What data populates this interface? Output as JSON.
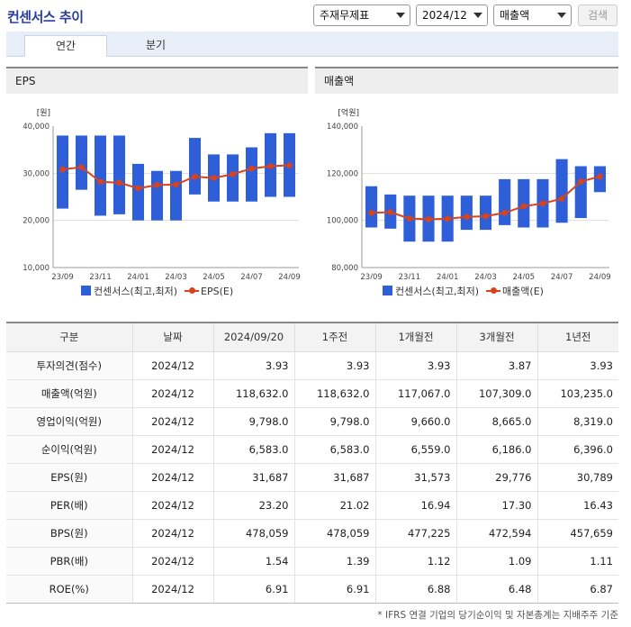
{
  "header": {
    "title": "컨센서스 추이",
    "select_report": "주재무제표",
    "select_period": "2024/12",
    "select_metric": "매출액",
    "search_label": "검색"
  },
  "tabs": [
    {
      "label": "연간",
      "active": true
    },
    {
      "label": "분기",
      "active": false
    }
  ],
  "colors": {
    "bar": "#2f5fd8",
    "line": "#d8431b",
    "title": "#2a3f9b"
  },
  "chart_data": [
    {
      "type": "bar",
      "panel_title": "EPS",
      "unit_label": "[원]",
      "x": [
        "23/09",
        "23/10",
        "23/11",
        "23/12",
        "24/01",
        "24/02",
        "24/03",
        "24/04",
        "24/05",
        "24/06",
        "24/07",
        "24/08",
        "24/09"
      ],
      "x_tick_labels": [
        "23/09",
        "23/11",
        "24/01",
        "24/03",
        "24/05",
        "24/07",
        "24/09"
      ],
      "y_ticks": [
        "40,000",
        "30,000",
        "20,000",
        "10,000"
      ],
      "ylim": [
        10000,
        40000
      ],
      "series": [
        {
          "name": "컨센서스(최고,최저)",
          "kind": "range_bar",
          "low": [
            22500,
            26500,
            21000,
            21300,
            20000,
            20000,
            20000,
            25500,
            24000,
            24000,
            24000,
            25000,
            25000
          ],
          "high": [
            38000,
            38000,
            38000,
            38000,
            32000,
            30500,
            30500,
            37500,
            34000,
            34000,
            35500,
            38500,
            38500
          ]
        },
        {
          "name": "EPS(E)",
          "kind": "line",
          "values": [
            30800,
            31300,
            28200,
            28000,
            26800,
            27500,
            27600,
            29300,
            29000,
            29800,
            31000,
            31500,
            31687
          ]
        }
      ]
    },
    {
      "type": "bar",
      "panel_title": "매출액",
      "unit_label": "[억원]",
      "x": [
        "23/09",
        "23/10",
        "23/11",
        "23/12",
        "24/01",
        "24/02",
        "24/03",
        "24/04",
        "24/05",
        "24/06",
        "24/07",
        "24/08",
        "24/09"
      ],
      "x_tick_labels": [
        "23/09",
        "23/11",
        "24/01",
        "24/03",
        "24/05",
        "24/07",
        "24/09"
      ],
      "y_ticks": [
        "140,000",
        "120,000",
        "100,000",
        "80,000"
      ],
      "ylim": [
        80000,
        140000
      ],
      "series": [
        {
          "name": "컨센서스(최고,최저)",
          "kind": "range_bar",
          "low": [
            97000,
            96500,
            91000,
            91000,
            91000,
            96000,
            96000,
            98000,
            97000,
            97000,
            99000,
            101000,
            112000
          ],
          "high": [
            114500,
            111000,
            110500,
            110500,
            110500,
            110500,
            110500,
            117500,
            117500,
            117500,
            126000,
            123000,
            123000
          ]
        },
        {
          "name": "매출액(E)",
          "kind": "line",
          "values": [
            103200,
            103500,
            100800,
            100500,
            100700,
            101500,
            101800,
            103200,
            106000,
            107200,
            109200,
            116500,
            118632
          ]
        }
      ]
    }
  ],
  "table": {
    "headers": [
      "구분",
      "날짜",
      "2024/09/20",
      "1주전",
      "1개월전",
      "3개월전",
      "1년전"
    ],
    "rows": [
      [
        "투자의견(점수)",
        "2024/12",
        "3.93",
        "3.93",
        "3.93",
        "3.87",
        "3.93"
      ],
      [
        "매출액(억원)",
        "2024/12",
        "118,632.0",
        "118,632.0",
        "117,067.0",
        "107,309.0",
        "103,235.0"
      ],
      [
        "영업이익(억원)",
        "2024/12",
        "9,798.0",
        "9,798.0",
        "9,660.0",
        "8,665.0",
        "8,319.0"
      ],
      [
        "순이익(억원)",
        "2024/12",
        "6,583.0",
        "6,583.0",
        "6,559.0",
        "6,186.0",
        "6,396.0"
      ],
      [
        "EPS(원)",
        "2024/12",
        "31,687",
        "31,687",
        "31,573",
        "29,776",
        "30,789"
      ],
      [
        "PER(배)",
        "2024/12",
        "23.20",
        "21.02",
        "16.94",
        "17.30",
        "16.43"
      ],
      [
        "BPS(원)",
        "2024/12",
        "478,059",
        "478,059",
        "477,225",
        "472,594",
        "457,659"
      ],
      [
        "PBR(배)",
        "2024/12",
        "1.54",
        "1.39",
        "1.12",
        "1.09",
        "1.11"
      ],
      [
        "ROE(%)",
        "2024/12",
        "6.91",
        "6.91",
        "6.88",
        "6.48",
        "6.87"
      ]
    ]
  },
  "footnote": "* IFRS 연결 기업의 당기순이익 및 자본총계는 지배주주 기준"
}
